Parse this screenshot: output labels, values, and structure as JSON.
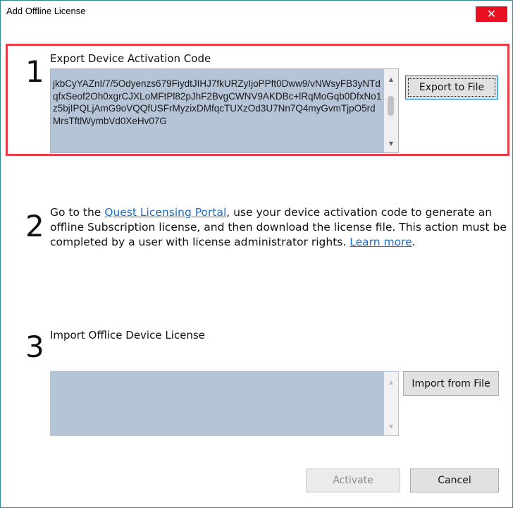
{
  "window": {
    "title": "Add Offline License",
    "close_glyph": "✕"
  },
  "step1": {
    "number": "1",
    "heading": "Export Device Activation Code",
    "activation_code": "jkbCyYAZnI/7/5Odyenzs679FiydtJIHJ7fkURZyIjoPPft0Dww9/vNWsyFB3yNTdqfxSeof2Oh0xgrCJXLoMFtPl82pJhF2BvgCWNV9AKDBc+lRqMoGqb0DfxNo1z5bjIPQLjAmG9oVQQfUSFrMyzixDMfqcTUXzOd3U7Nn7Q4myGvmTjpO5rdMrsTftlWymbVd0XeHv07G",
    "export_button": "Export to File"
  },
  "step2": {
    "number": "2",
    "text_before_link": "Go to the ",
    "portal_link": "Quest Licensing Portal",
    "text_middle": ", use your device activation code to generate an offline Subscription license, and then download the license file. This action must be completed by a user with license administrator rights. ",
    "learn_more_link": "Learn more",
    "text_end": "."
  },
  "step3": {
    "number": "3",
    "heading": "Import Offlice Device License",
    "import_value": "",
    "import_button": "Import from File"
  },
  "footer": {
    "activate_button": "Activate",
    "cancel_button": "Cancel"
  },
  "colors": {
    "highlight_border": "#e83c48",
    "close_button": "#e81123",
    "textbox_background": "#b6c4d7",
    "link": "#1a6fc9"
  }
}
